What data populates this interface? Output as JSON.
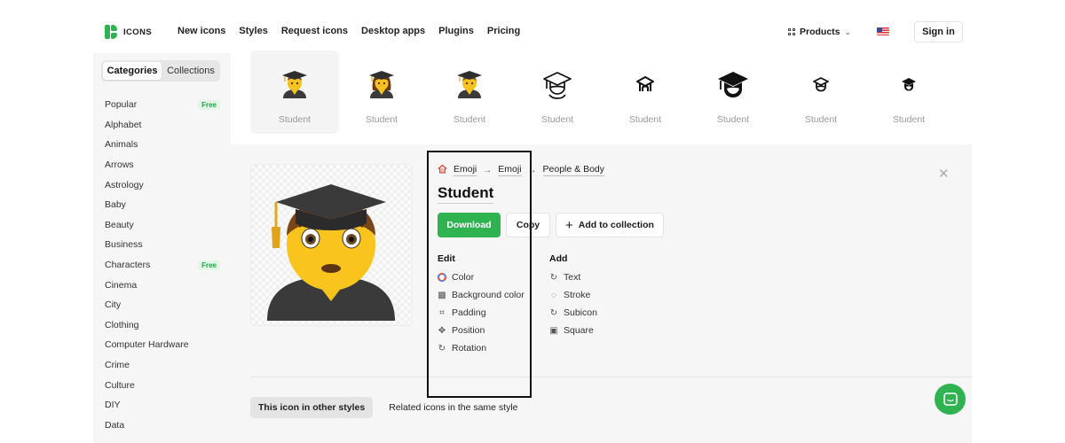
{
  "brand": {
    "name": "ICONS",
    "accent": "#2fb351"
  },
  "nav": [
    "New icons",
    "Styles",
    "Request icons",
    "Desktop apps",
    "Plugins",
    "Pricing"
  ],
  "header_right": {
    "products_label": "Products",
    "signin_label": "Sign in",
    "flag_icon": "us-flag-icon"
  },
  "sidebar": {
    "tabs": [
      {
        "label": "Categories",
        "active": true
      },
      {
        "label": "Collections",
        "active": false
      }
    ],
    "categories": [
      {
        "label": "Popular",
        "badge": "Free"
      },
      {
        "label": "Alphabet"
      },
      {
        "label": "Animals"
      },
      {
        "label": "Arrows"
      },
      {
        "label": "Astrology"
      },
      {
        "label": "Baby"
      },
      {
        "label": "Beauty"
      },
      {
        "label": "Business"
      },
      {
        "label": "Characters",
        "badge": "Free"
      },
      {
        "label": "Cinema"
      },
      {
        "label": "City"
      },
      {
        "label": "Clothing"
      },
      {
        "label": "Computer Hardware"
      },
      {
        "label": "Crime"
      },
      {
        "label": "Culture"
      },
      {
        "label": "DIY"
      },
      {
        "label": "Data"
      }
    ]
  },
  "variants": [
    {
      "label": "Student",
      "style": "emoji-man",
      "selected": true
    },
    {
      "label": "Student",
      "style": "emoji-woman"
    },
    {
      "label": "Student",
      "style": "emoji-person"
    },
    {
      "label": "Student",
      "style": "outline-large"
    },
    {
      "label": "Student",
      "style": "outline-small"
    },
    {
      "label": "Student",
      "style": "filled-large"
    },
    {
      "label": "Student",
      "style": "outline-mini"
    },
    {
      "label": "Student",
      "style": "filled-mini"
    }
  ],
  "detail": {
    "breadcrumb": [
      "Emoji",
      "Emoji",
      "People & Body"
    ],
    "title": "Student",
    "download_label": "Download",
    "copy_label": "Copy",
    "add_collection_label": "Add to collection",
    "edit": {
      "heading": "Edit",
      "items": [
        {
          "label": "Color",
          "icon": "color-wheel-icon"
        },
        {
          "label": "Background color",
          "icon": "checker-icon"
        },
        {
          "label": "Padding",
          "icon": "padding-icon"
        },
        {
          "label": "Position",
          "icon": "move-icon"
        },
        {
          "label": "Rotation",
          "icon": "rotate-icon"
        }
      ]
    },
    "add": {
      "heading": "Add",
      "items": [
        {
          "label": "Text",
          "icon": "text-icon"
        },
        {
          "label": "Stroke",
          "icon": "stroke-icon"
        },
        {
          "label": "Subicon",
          "icon": "subicon-icon"
        },
        {
          "label": "Square",
          "icon": "square-icon"
        }
      ]
    }
  },
  "bottom_tabs": [
    {
      "label": "This icon in other styles",
      "active": true
    },
    {
      "label": "Related icons in the same style",
      "active": false
    }
  ]
}
